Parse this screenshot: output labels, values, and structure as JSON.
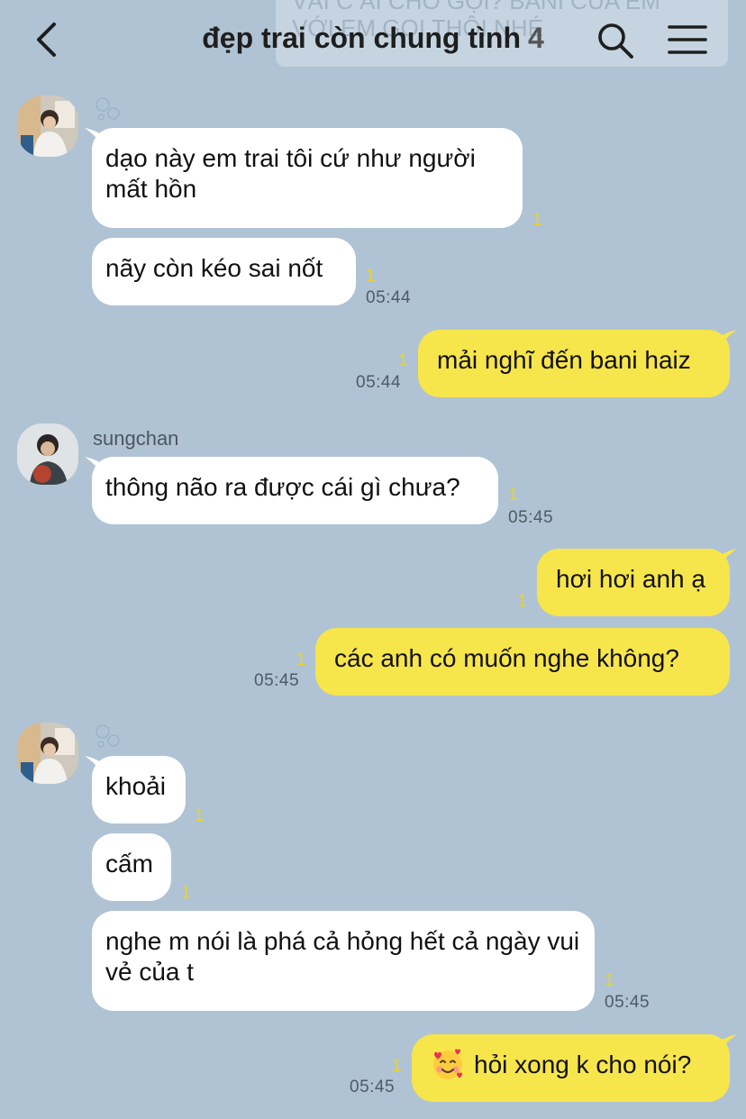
{
  "header": {
    "title": "đẹp trai còn chung tình",
    "member_count": "4",
    "ghost_banner_line1": "VẢI C ẤI CHO GỌI? BANI CỦA EM",
    "ghost_banner_line2": "VỚI EM GỌI THÔI NHÉ"
  },
  "messages": [
    {
      "side": "in",
      "text": "dạo này em trai tôi cứ như người mất hồn",
      "read": "1",
      "time": ""
    },
    {
      "side": "in",
      "text": "nãy còn kéo sai nốt",
      "read": "1",
      "time": "05:44"
    },
    {
      "side": "out",
      "text": "mải nghĩ đến bani haiz",
      "read": "1",
      "time": "05:44"
    },
    {
      "side": "in",
      "sender": "sungchan",
      "text": "thông não ra được cái gì chưa?",
      "read": "1",
      "time": "05:45"
    },
    {
      "side": "out",
      "text": "hơi hơi anh ạ",
      "read": "1",
      "time": ""
    },
    {
      "side": "out",
      "text": "các anh có muốn nghe không?",
      "read": "1",
      "time": "05:45"
    },
    {
      "side": "in",
      "text": "khoải",
      "read": "1",
      "time": ""
    },
    {
      "side": "in",
      "text": "cấm",
      "read": "1",
      "time": ""
    },
    {
      "side": "in",
      "text": "nghe m nói là phá cả hỏng hết cả ngày vui vẻ của t",
      "read": "1",
      "time": "05:45"
    },
    {
      "side": "out",
      "text": "hỏi xong k cho nói?",
      "emoji": "smiling-face-with-hearts",
      "read": "1",
      "time": "05:45"
    }
  ],
  "colors": {
    "background": "#b0c3d4",
    "incoming_bubble": "#ffffff",
    "outgoing_bubble": "#f7e54c",
    "read_count": "#e8d42a",
    "timestamp": "#4f5a66"
  }
}
